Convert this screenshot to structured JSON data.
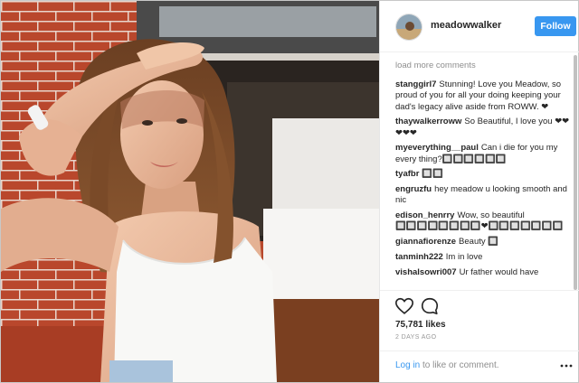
{
  "post": {
    "username": "meadowwalker",
    "follow_label": "Follow",
    "load_more_label": "load more comments",
    "likes": "75,781 likes",
    "timestamp": "2 DAYS AGO",
    "login_link": "Log in",
    "login_suffix": " to like or comment."
  },
  "comments": [
    {
      "user": "stanggirl7",
      "text": "Stunning! Love you Meadow, so proud of you for all your doing keeping your dad's legacy alive aside from ROWW. ❤"
    },
    {
      "user": "thaywalkerroww",
      "text": "So Beautiful, I love you ❤❤❤❤❤"
    },
    {
      "user": "myeverything__paul",
      "text": "Can i die for you my every thing?🔲🔲🔲🔲🔲🔲"
    },
    {
      "user": "tyafbr",
      "text": "🔲🔲"
    },
    {
      "user": "engruzfu",
      "text": "hey meadow u looking smooth and nic"
    },
    {
      "user": "edison_henrry",
      "text": "Wow, so beautiful 🔲🔲🔲🔲🔲🔲🔲🔲❤🔲🔲🔲🔲🔲🔲🔲"
    },
    {
      "user": "giannafiorenze",
      "text": "Beauty 🔲"
    },
    {
      "user": "tanminh222",
      "text": "Im in love"
    },
    {
      "user": "vishalsowri007",
      "text": "Ur father would have"
    }
  ],
  "icons": {
    "like": "heart-outline-icon",
    "comment": "speech-bubble-icon",
    "more": "more-options-icon"
  },
  "colors": {
    "accent": "#3897f0",
    "wall": "#b8482c"
  }
}
